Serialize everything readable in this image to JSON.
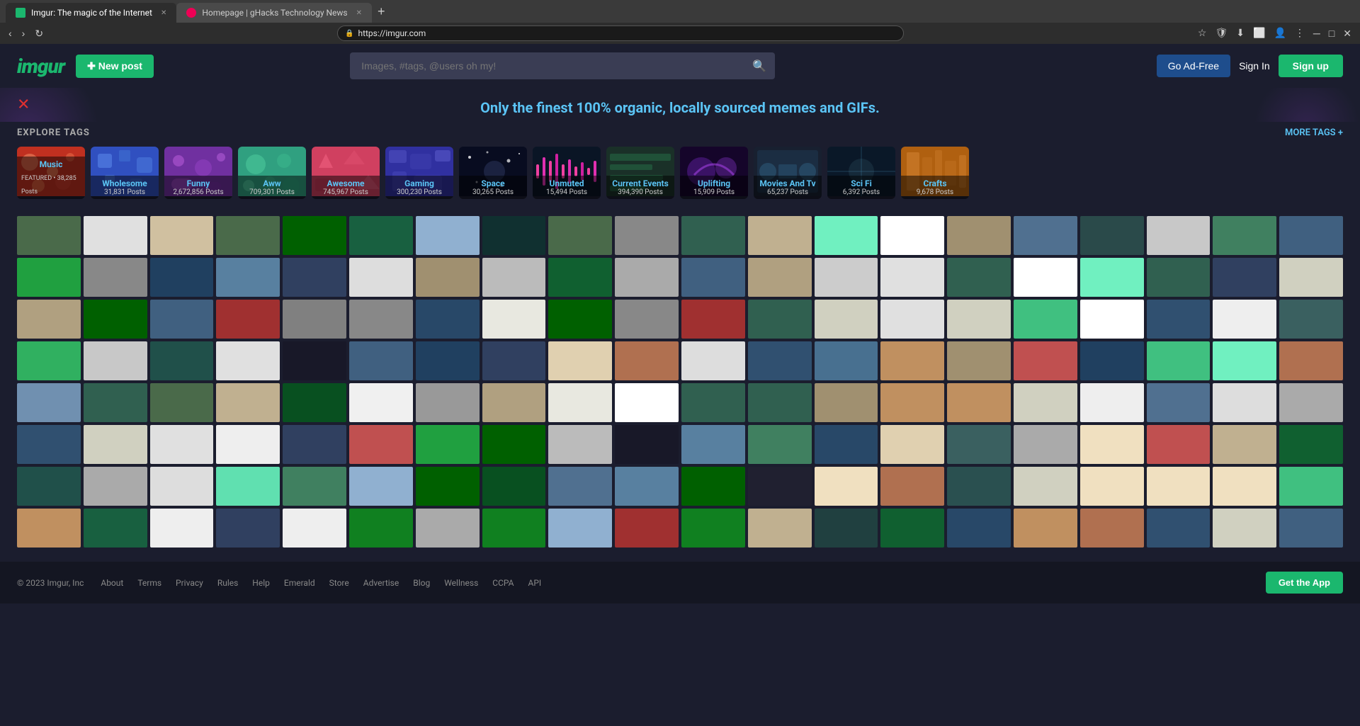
{
  "browser": {
    "tabs": [
      {
        "id": "imgur",
        "title": "Imgur: The magic of the Internet",
        "active": true,
        "favicon": "imgur"
      },
      {
        "id": "ghacks",
        "title": "Homepage | gHacks Technology News",
        "active": false,
        "favicon": "ghacks"
      }
    ],
    "url": "https://imgur.com"
  },
  "header": {
    "logo": "imgur",
    "new_post_label": "✚  New post",
    "search_placeholder": "Images, #tags, @users oh my!",
    "go_ad_free_label": "Go Ad-Free",
    "sign_in_label": "Sign In",
    "sign_up_label": "Sign up"
  },
  "hero": {
    "tagline": "Only the finest 100% organic, locally sourced memes and GIFs."
  },
  "explore_tags": {
    "title": "EXPLORE TAGS",
    "more_tags_label": "MORE TAGS +",
    "tags": [
      {
        "id": "music",
        "name": "Music",
        "posts": "38,285 Posts",
        "featured": "FEATURED •",
        "bg": "#e05020",
        "pattern": "music"
      },
      {
        "id": "wholesome",
        "name": "Wholesome",
        "posts": "31,831 Posts",
        "featured": "",
        "bg": "#3050c0",
        "pattern": "wholesome"
      },
      {
        "id": "funny",
        "name": "Funny",
        "posts": "2,672,856 Posts",
        "featured": "",
        "bg": "#9050c0",
        "pattern": "funny"
      },
      {
        "id": "aww",
        "name": "Aww",
        "posts": "709,301 Posts",
        "featured": "",
        "bg": "#40c0a0",
        "pattern": "aww"
      },
      {
        "id": "awesome",
        "name": "Awesome",
        "posts": "745,967 Posts",
        "featured": "",
        "bg": "#e05080",
        "pattern": "awesome"
      },
      {
        "id": "gaming",
        "name": "Gaming",
        "posts": "300,230 Posts",
        "featured": "",
        "bg": "#5050c0",
        "pattern": "gaming"
      },
      {
        "id": "space",
        "name": "Space",
        "posts": "30,265 Posts",
        "featured": "",
        "bg": "#101830",
        "pattern": "space"
      },
      {
        "id": "unmuted",
        "name": "Unmuted",
        "posts": "15,494 Posts",
        "featured": "",
        "bg": "#0d1a2e",
        "pattern": "unmuted"
      },
      {
        "id": "current",
        "name": "Current Events",
        "posts": "394,390 Posts",
        "featured": "",
        "bg": "#205040",
        "pattern": "current"
      },
      {
        "id": "uplifting",
        "name": "Uplifting",
        "posts": "15,909 Posts",
        "featured": "",
        "bg": "#200d40",
        "pattern": "uplifting"
      },
      {
        "id": "movies",
        "name": "Movies And Tv",
        "posts": "65,237 Posts",
        "featured": "",
        "bg": "#204060",
        "pattern": "movies"
      },
      {
        "id": "scifi",
        "name": "Sci Fi",
        "posts": "6,392 Posts",
        "featured": "",
        "bg": "#102030",
        "pattern": "scifi"
      },
      {
        "id": "crafts",
        "name": "Crafts",
        "posts": "9,678 Posts",
        "featured": "",
        "bg": "#d08020",
        "pattern": "crafts"
      }
    ]
  },
  "footer": {
    "copyright": "© 2023 Imgur, Inc",
    "links": [
      "About",
      "Terms",
      "Privacy",
      "Rules",
      "Help",
      "Emerald",
      "Store",
      "Advertise",
      "Blog",
      "Wellness",
      "CCPA",
      "API"
    ],
    "get_app_label": "Get the App"
  }
}
